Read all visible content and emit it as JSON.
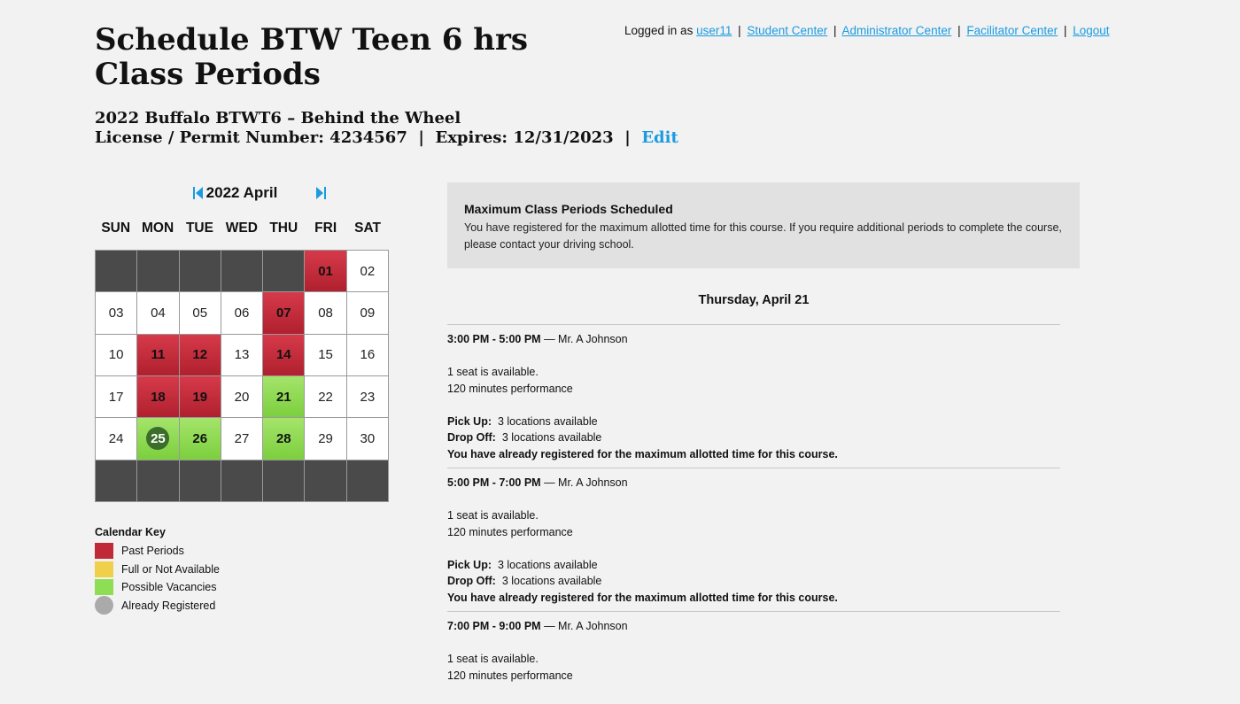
{
  "page": {
    "title": "Schedule BTW Teen 6 hrs Class Periods",
    "course": "2022 Buffalo BTWT6 – Behind the Wheel",
    "license_label": "License / Permit Number:",
    "license_number": "4234567",
    "expires_label": "Expires:",
    "expires_date": "12/31/2023",
    "edit_label": "Edit"
  },
  "topnav": {
    "logged_in_as": "Logged in as",
    "user": "user11",
    "links": [
      "Student Center",
      "Administrator Center",
      "Facilitator Center",
      "Logout"
    ]
  },
  "calendar": {
    "month_label": "2022 April",
    "weekdays": [
      "SUN",
      "MON",
      "TUE",
      "WED",
      "THU",
      "FRI",
      "SAT"
    ],
    "cells": [
      {
        "day": "",
        "state": "empty"
      },
      {
        "day": "",
        "state": "empty"
      },
      {
        "day": "",
        "state": "empty"
      },
      {
        "day": "",
        "state": "empty"
      },
      {
        "day": "",
        "state": "empty"
      },
      {
        "day": "01",
        "state": "past"
      },
      {
        "day": "02",
        "state": "normal"
      },
      {
        "day": "03",
        "state": "normal"
      },
      {
        "day": "04",
        "state": "normal"
      },
      {
        "day": "05",
        "state": "normal"
      },
      {
        "day": "06",
        "state": "normal"
      },
      {
        "day": "07",
        "state": "past"
      },
      {
        "day": "08",
        "state": "normal"
      },
      {
        "day": "09",
        "state": "normal"
      },
      {
        "day": "10",
        "state": "normal"
      },
      {
        "day": "11",
        "state": "past"
      },
      {
        "day": "12",
        "state": "past"
      },
      {
        "day": "13",
        "state": "normal"
      },
      {
        "day": "14",
        "state": "past"
      },
      {
        "day": "15",
        "state": "normal"
      },
      {
        "day": "16",
        "state": "normal"
      },
      {
        "day": "17",
        "state": "normal"
      },
      {
        "day": "18",
        "state": "past"
      },
      {
        "day": "19",
        "state": "past"
      },
      {
        "day": "20",
        "state": "normal"
      },
      {
        "day": "21",
        "state": "vacancy"
      },
      {
        "day": "22",
        "state": "normal"
      },
      {
        "day": "23",
        "state": "normal"
      },
      {
        "day": "24",
        "state": "normal"
      },
      {
        "day": "25",
        "state": "registered"
      },
      {
        "day": "26",
        "state": "vacancy"
      },
      {
        "day": "27",
        "state": "normal"
      },
      {
        "day": "28",
        "state": "vacancy"
      },
      {
        "day": "29",
        "state": "normal"
      },
      {
        "day": "30",
        "state": "normal"
      },
      {
        "day": "",
        "state": "empty"
      },
      {
        "day": "",
        "state": "empty"
      },
      {
        "day": "",
        "state": "empty"
      },
      {
        "day": "",
        "state": "empty"
      },
      {
        "day": "",
        "state": "empty"
      },
      {
        "day": "",
        "state": "empty"
      },
      {
        "day": "",
        "state": "empty"
      }
    ]
  },
  "key": {
    "title": "Calendar Key",
    "items": [
      {
        "label": "Past Periods",
        "color": "#c02a38"
      },
      {
        "label": "Full or Not Available",
        "color": "#f0d04a"
      },
      {
        "label": "Possible Vacancies",
        "color": "#8fdc55"
      },
      {
        "label": "Already Registered",
        "color": "#aaaaaa"
      }
    ]
  },
  "notice": {
    "title": "Maximum Class Periods Scheduled",
    "body": "You have registered for the maximum allotted time for this course. If you require additional periods to complete the course, please contact your driving school."
  },
  "day": {
    "title": "Thursday, April 21",
    "slots": [
      {
        "time": "3:00 PM - 5:00 PM",
        "instructor": "— Mr. A Johnson",
        "seats": "1 seat is available.",
        "performance": "120 minutes performance",
        "pickup_label": "Pick Up:",
        "pickup": "3 locations available",
        "dropoff_label": "Drop Off:",
        "dropoff": "3 locations available",
        "warning": "You have already registered for the maximum allotted time for this course."
      },
      {
        "time": "5:00 PM - 7:00 PM",
        "instructor": "— Mr. A Johnson",
        "seats": "1 seat is available.",
        "performance": "120 minutes performance",
        "pickup_label": "Pick Up:",
        "pickup": "3 locations available",
        "dropoff_label": "Drop Off:",
        "dropoff": "3 locations available",
        "warning": "You have already registered for the maximum allotted time for this course."
      },
      {
        "time": "7:00 PM - 9:00 PM",
        "instructor": "— Mr. A Johnson",
        "seats": "1 seat is available.",
        "performance": "120 minutes performance"
      }
    ]
  }
}
